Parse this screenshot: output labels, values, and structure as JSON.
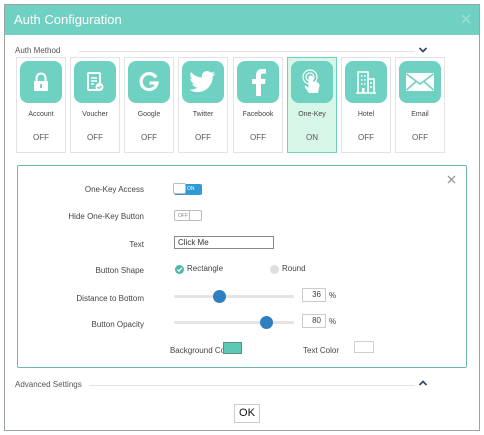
{
  "dialog": {
    "title": "Auth Configuration"
  },
  "auth_method": {
    "label": "Auth Method",
    "tiles": [
      {
        "name": "Account",
        "state": "OFF",
        "icon": "lock-icon"
      },
      {
        "name": "Voucher",
        "state": "OFF",
        "icon": "voucher-icon"
      },
      {
        "name": "Google",
        "state": "OFF",
        "icon": "google-icon"
      },
      {
        "name": "Twitter",
        "state": "OFF",
        "icon": "twitter-icon"
      },
      {
        "name": "Facebook",
        "state": "OFF",
        "icon": "facebook-icon"
      },
      {
        "name": "One-Key",
        "state": "ON",
        "icon": "tap-icon",
        "selected": true
      },
      {
        "name": "Hotel",
        "state": "OFF",
        "icon": "hotel-icon"
      },
      {
        "name": "Email",
        "state": "OFF",
        "icon": "email-icon"
      }
    ]
  },
  "settings": {
    "one_key_access": {
      "label": "One-Key Access",
      "toggle_text": "ON"
    },
    "hide_button": {
      "label": "Hide One-Key Button",
      "toggle_text": "OFF"
    },
    "text": {
      "label": "Text",
      "value": "Click Me"
    },
    "button_shape": {
      "label": "Button Shape",
      "option_rectangle": "Rectangle",
      "option_round": "Round",
      "selected": "Rectangle"
    },
    "distance": {
      "label": "Distance to Bottom",
      "value": "36",
      "unit": "%"
    },
    "opacity": {
      "label": "Button Opacity",
      "value": "80",
      "unit": "%"
    },
    "background_color": {
      "label": "Background Color",
      "color": "#5dc9b5"
    },
    "text_color": {
      "label": "Text Color",
      "color": "#ffffff"
    }
  },
  "advanced": {
    "label": "Advanced Settings"
  },
  "footer": {
    "ok_label": "OK"
  },
  "colors": {
    "accent": "#6fd1c1",
    "selected_tile": "#d8f6e8",
    "toggle_on": "#2e9ad6",
    "slider_thumb": "#2f7ec0",
    "radio_checked": "#4db6a6"
  }
}
